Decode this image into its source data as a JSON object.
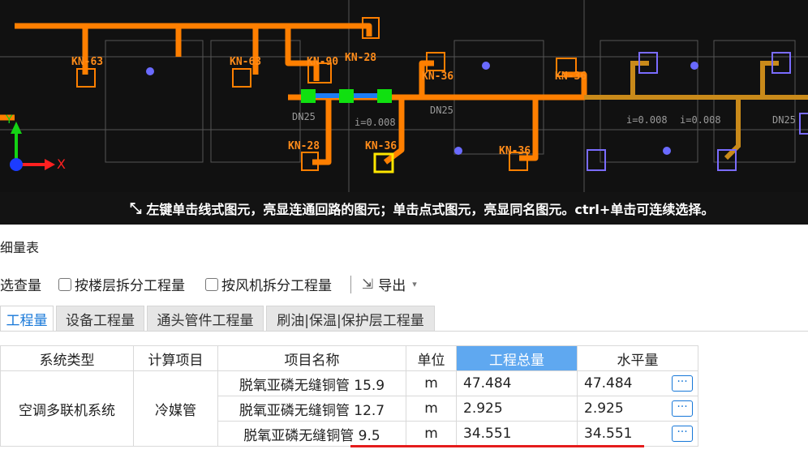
{
  "cad": {
    "pipe_labels": [
      "KN-63",
      "KN-63",
      "KN-90",
      "KN-28",
      "KN-36",
      "KN-36",
      "KN-28",
      "KN-36",
      "KN-36"
    ],
    "misc_labels": [
      "DN25",
      "i=0.008",
      "DN25",
      "i=0.008",
      "DN25",
      "i=0.008"
    ],
    "axis_x": "X",
    "axis_y": "Y",
    "hint_text": "左键单击线式图元，亮显连通回路的图元；单击点式图元，亮显同名图元。ctrl+单击可连续选择。",
    "colors": {
      "pipe": "#ff7f00",
      "selected": "#1c7cf4",
      "node": "#10e010",
      "background": "#111111"
    }
  },
  "panel": {
    "title": "细量表",
    "toolbar": {
      "filter_label": "选查量",
      "split_floor_label": "按楼层拆分工程量",
      "split_fan_label": "按风机拆分工程量",
      "export_label": "导出"
    },
    "tabs": [
      {
        "label": "工程量",
        "active": true
      },
      {
        "label": "设备工程量",
        "active": false
      },
      {
        "label": "通头管件工程量",
        "active": false
      },
      {
        "label": "刷油|保温|保护层工程量",
        "active": false
      }
    ],
    "table": {
      "headers": [
        "系统类型",
        "计算项目",
        "项目名称",
        "单位",
        "工程总量",
        "水平量"
      ],
      "system_type": "空调多联机系统",
      "calc_item": "冷媒管",
      "rows": [
        {
          "name": "脱氧亚磷无缝铜管 15.9",
          "unit": "m",
          "total": "47.484",
          "horizontal": "47.484"
        },
        {
          "name": "脱氧亚磷无缝铜管 12.7",
          "unit": "m",
          "total": "2.925",
          "horizontal": "2.925"
        },
        {
          "name": "脱氧亚磷无缝铜管 9.5",
          "unit": "m",
          "total": "34.551",
          "horizontal": "34.551"
        }
      ],
      "more_label": "···"
    }
  }
}
